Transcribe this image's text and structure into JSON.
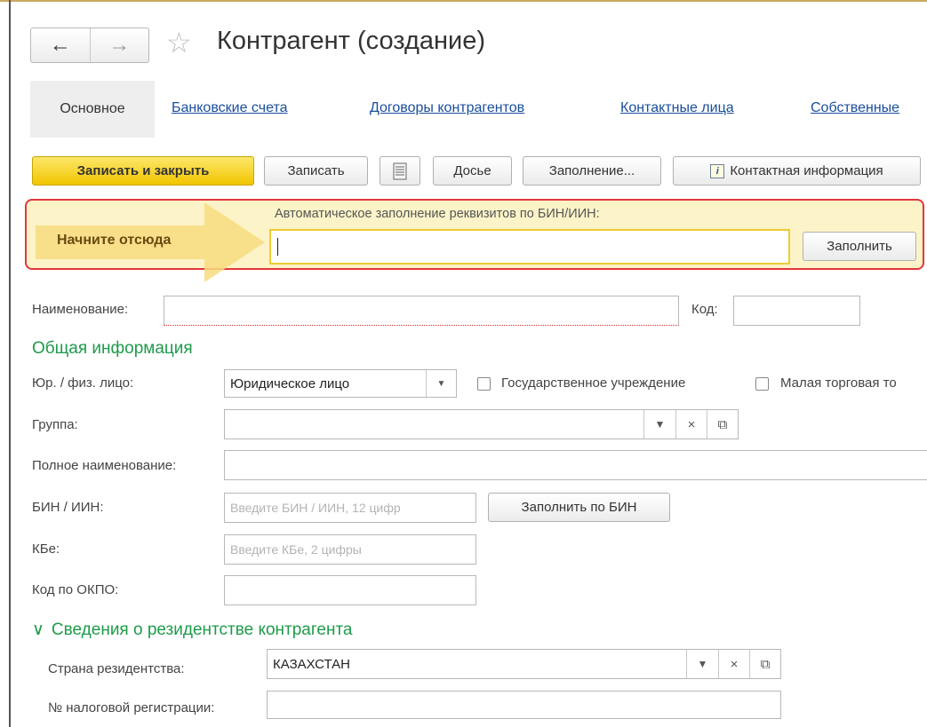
{
  "window": {
    "title": "Контрагент (создание)",
    "nav_back": "←",
    "nav_forward": "→",
    "star": "☆"
  },
  "tabs": [
    {
      "label": "Основное",
      "active": true
    },
    {
      "label": "Банковские счета"
    },
    {
      "label": "Договоры контрагентов"
    },
    {
      "label": "Контактные лица"
    },
    {
      "label": "Собственные"
    }
  ],
  "toolbar": {
    "save_close": "Записать и закрыть",
    "save": "Записать",
    "dossier": "Досье",
    "fill": "Заполнение...",
    "contact_info": "Контактная информация",
    "info_icon_glyph": "i",
    "accent": "#f2c500"
  },
  "autofill": {
    "hint": "Начните отсюда",
    "label": "Автоматическое заполнение реквизитов по БИН/ИИН:",
    "input_value": "",
    "button": "Заполнить",
    "border_color": "#e3363c"
  },
  "form": {
    "name_label": "Наименование:",
    "name_value": "",
    "code_label": "Код:",
    "code_value": "",
    "section_general": "Общая информация",
    "legal_type_label": "Юр. / физ. лицо:",
    "legal_type_value": "Юридическое лицо",
    "gov_checkbox_label": "Государственное учреждение",
    "gov_checked": false,
    "small_trade_label": "Малая торговая то",
    "small_trade_checked": false,
    "group_label": "Группа:",
    "group_value": "",
    "full_name_label": "Полное наименование:",
    "full_name_value": "",
    "bin_label": "БИН / ИИН:",
    "bin_placeholder": "Введите БИН / ИИН, 12 цифр",
    "bin_fill_button": "Заполнить по БИН",
    "kbe_label": "КБе:",
    "kbe_placeholder": "Введите КБе, 2 цифры",
    "okpo_label": "Код по ОКПО:",
    "okpo_value": "",
    "section_residency": "Сведения о резидентстве контрагента",
    "residency_country_label": "Страна резидентства:",
    "residency_country_value": "КАЗАХСТАН",
    "tax_reg_label": "№ налоговой регистрации:",
    "tax_reg_value": ""
  },
  "glyphs": {
    "dropdown": "▼",
    "clear": "×",
    "open": "⧉",
    "chevron": "∨"
  },
  "colors": {
    "link": "#1a4e9b",
    "section": "#1e9b4a",
    "highlight_bg": "#fcf4c8"
  }
}
